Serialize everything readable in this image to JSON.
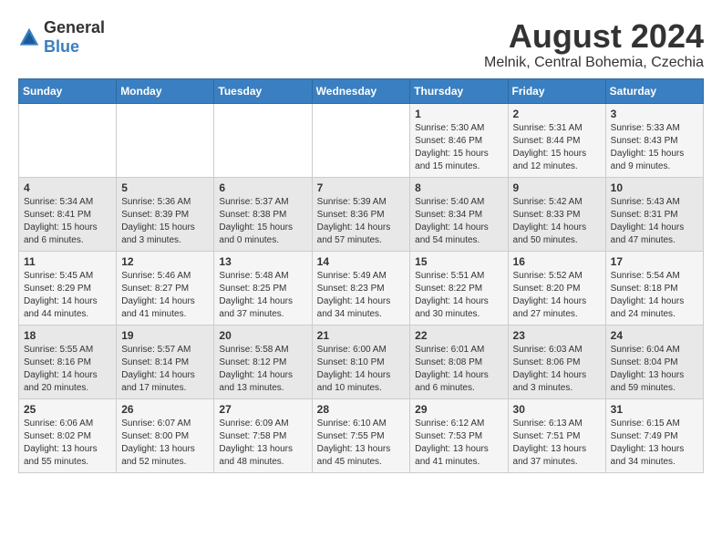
{
  "logo": {
    "text_general": "General",
    "text_blue": "Blue"
  },
  "title": {
    "month_year": "August 2024",
    "location": "Melnik, Central Bohemia, Czechia"
  },
  "weekdays": [
    "Sunday",
    "Monday",
    "Tuesday",
    "Wednesday",
    "Thursday",
    "Friday",
    "Saturday"
  ],
  "weeks": [
    [
      {
        "day": "",
        "sunrise": "",
        "sunset": "",
        "daylight": ""
      },
      {
        "day": "",
        "sunrise": "",
        "sunset": "",
        "daylight": ""
      },
      {
        "day": "",
        "sunrise": "",
        "sunset": "",
        "daylight": ""
      },
      {
        "day": "",
        "sunrise": "",
        "sunset": "",
        "daylight": ""
      },
      {
        "day": "1",
        "sunrise": "Sunrise: 5:30 AM",
        "sunset": "Sunset: 8:46 PM",
        "daylight": "Daylight: 15 hours and 15 minutes."
      },
      {
        "day": "2",
        "sunrise": "Sunrise: 5:31 AM",
        "sunset": "Sunset: 8:44 PM",
        "daylight": "Daylight: 15 hours and 12 minutes."
      },
      {
        "day": "3",
        "sunrise": "Sunrise: 5:33 AM",
        "sunset": "Sunset: 8:43 PM",
        "daylight": "Daylight: 15 hours and 9 minutes."
      }
    ],
    [
      {
        "day": "4",
        "sunrise": "Sunrise: 5:34 AM",
        "sunset": "Sunset: 8:41 PM",
        "daylight": "Daylight: 15 hours and 6 minutes."
      },
      {
        "day": "5",
        "sunrise": "Sunrise: 5:36 AM",
        "sunset": "Sunset: 8:39 PM",
        "daylight": "Daylight: 15 hours and 3 minutes."
      },
      {
        "day": "6",
        "sunrise": "Sunrise: 5:37 AM",
        "sunset": "Sunset: 8:38 PM",
        "daylight": "Daylight: 15 hours and 0 minutes."
      },
      {
        "day": "7",
        "sunrise": "Sunrise: 5:39 AM",
        "sunset": "Sunset: 8:36 PM",
        "daylight": "Daylight: 14 hours and 57 minutes."
      },
      {
        "day": "8",
        "sunrise": "Sunrise: 5:40 AM",
        "sunset": "Sunset: 8:34 PM",
        "daylight": "Daylight: 14 hours and 54 minutes."
      },
      {
        "day": "9",
        "sunrise": "Sunrise: 5:42 AM",
        "sunset": "Sunset: 8:33 PM",
        "daylight": "Daylight: 14 hours and 50 minutes."
      },
      {
        "day": "10",
        "sunrise": "Sunrise: 5:43 AM",
        "sunset": "Sunset: 8:31 PM",
        "daylight": "Daylight: 14 hours and 47 minutes."
      }
    ],
    [
      {
        "day": "11",
        "sunrise": "Sunrise: 5:45 AM",
        "sunset": "Sunset: 8:29 PM",
        "daylight": "Daylight: 14 hours and 44 minutes."
      },
      {
        "day": "12",
        "sunrise": "Sunrise: 5:46 AM",
        "sunset": "Sunset: 8:27 PM",
        "daylight": "Daylight: 14 hours and 41 minutes."
      },
      {
        "day": "13",
        "sunrise": "Sunrise: 5:48 AM",
        "sunset": "Sunset: 8:25 PM",
        "daylight": "Daylight: 14 hours and 37 minutes."
      },
      {
        "day": "14",
        "sunrise": "Sunrise: 5:49 AM",
        "sunset": "Sunset: 8:23 PM",
        "daylight": "Daylight: 14 hours and 34 minutes."
      },
      {
        "day": "15",
        "sunrise": "Sunrise: 5:51 AM",
        "sunset": "Sunset: 8:22 PM",
        "daylight": "Daylight: 14 hours and 30 minutes."
      },
      {
        "day": "16",
        "sunrise": "Sunrise: 5:52 AM",
        "sunset": "Sunset: 8:20 PM",
        "daylight": "Daylight: 14 hours and 27 minutes."
      },
      {
        "day": "17",
        "sunrise": "Sunrise: 5:54 AM",
        "sunset": "Sunset: 8:18 PM",
        "daylight": "Daylight: 14 hours and 24 minutes."
      }
    ],
    [
      {
        "day": "18",
        "sunrise": "Sunrise: 5:55 AM",
        "sunset": "Sunset: 8:16 PM",
        "daylight": "Daylight: 14 hours and 20 minutes."
      },
      {
        "day": "19",
        "sunrise": "Sunrise: 5:57 AM",
        "sunset": "Sunset: 8:14 PM",
        "daylight": "Daylight: 14 hours and 17 minutes."
      },
      {
        "day": "20",
        "sunrise": "Sunrise: 5:58 AM",
        "sunset": "Sunset: 8:12 PM",
        "daylight": "Daylight: 14 hours and 13 minutes."
      },
      {
        "day": "21",
        "sunrise": "Sunrise: 6:00 AM",
        "sunset": "Sunset: 8:10 PM",
        "daylight": "Daylight: 14 hours and 10 minutes."
      },
      {
        "day": "22",
        "sunrise": "Sunrise: 6:01 AM",
        "sunset": "Sunset: 8:08 PM",
        "daylight": "Daylight: 14 hours and 6 minutes."
      },
      {
        "day": "23",
        "sunrise": "Sunrise: 6:03 AM",
        "sunset": "Sunset: 8:06 PM",
        "daylight": "Daylight: 14 hours and 3 minutes."
      },
      {
        "day": "24",
        "sunrise": "Sunrise: 6:04 AM",
        "sunset": "Sunset: 8:04 PM",
        "daylight": "Daylight: 13 hours and 59 minutes."
      }
    ],
    [
      {
        "day": "25",
        "sunrise": "Sunrise: 6:06 AM",
        "sunset": "Sunset: 8:02 PM",
        "daylight": "Daylight: 13 hours and 55 minutes."
      },
      {
        "day": "26",
        "sunrise": "Sunrise: 6:07 AM",
        "sunset": "Sunset: 8:00 PM",
        "daylight": "Daylight: 13 hours and 52 minutes."
      },
      {
        "day": "27",
        "sunrise": "Sunrise: 6:09 AM",
        "sunset": "Sunset: 7:58 PM",
        "daylight": "Daylight: 13 hours and 48 minutes."
      },
      {
        "day": "28",
        "sunrise": "Sunrise: 6:10 AM",
        "sunset": "Sunset: 7:55 PM",
        "daylight": "Daylight: 13 hours and 45 minutes."
      },
      {
        "day": "29",
        "sunrise": "Sunrise: 6:12 AM",
        "sunset": "Sunset: 7:53 PM",
        "daylight": "Daylight: 13 hours and 41 minutes."
      },
      {
        "day": "30",
        "sunrise": "Sunrise: 6:13 AM",
        "sunset": "Sunset: 7:51 PM",
        "daylight": "Daylight: 13 hours and 37 minutes."
      },
      {
        "day": "31",
        "sunrise": "Sunrise: 6:15 AM",
        "sunset": "Sunset: 7:49 PM",
        "daylight": "Daylight: 13 hours and 34 minutes."
      }
    ]
  ]
}
